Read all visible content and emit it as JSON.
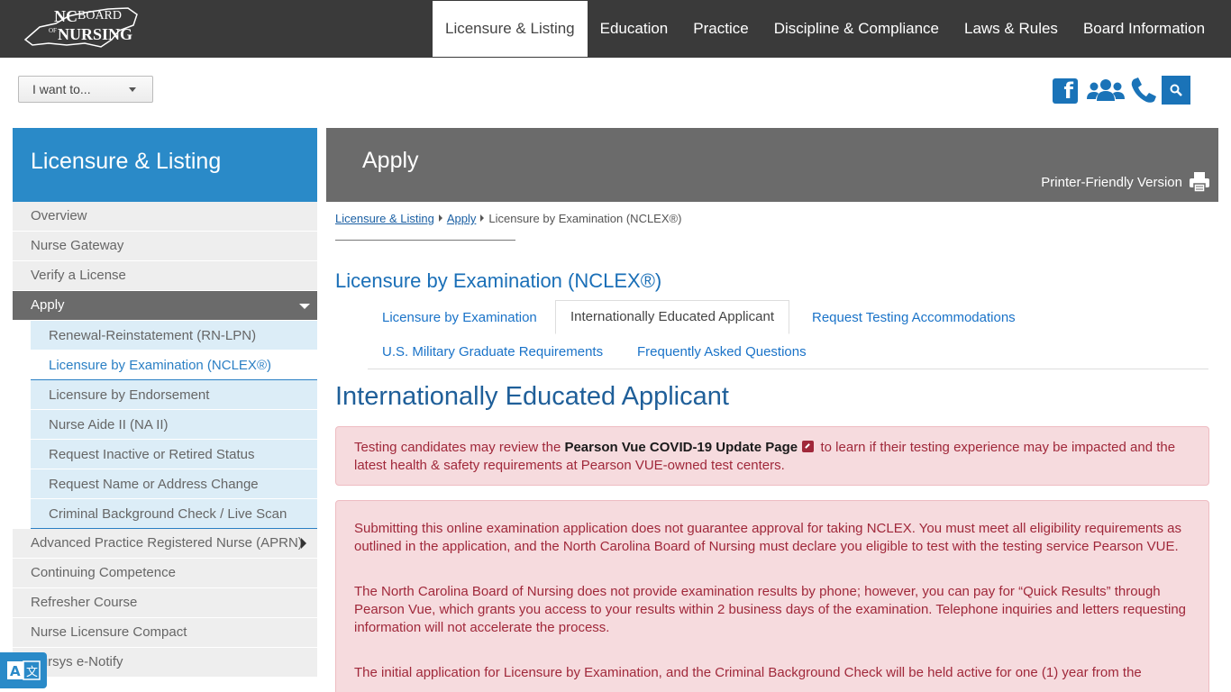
{
  "header": {
    "logo_text": "NC Board of Nursing",
    "nav": [
      {
        "label": "Licensure & Listing",
        "active": true
      },
      {
        "label": "Education"
      },
      {
        "label": "Practice"
      },
      {
        "label": "Discipline & Compliance"
      },
      {
        "label": "Laws & Rules"
      },
      {
        "label": "Board Information"
      }
    ]
  },
  "toolbar": {
    "i_want_to": "I want to...",
    "icons": [
      "facebook-icon",
      "people-icon",
      "phone-icon",
      "search-icon"
    ],
    "accent_color": "#1a73b8"
  },
  "sidebar": {
    "title": "Licensure & Listing",
    "items": [
      {
        "label": "Overview"
      },
      {
        "label": "Nurse Gateway"
      },
      {
        "label": "Verify a License"
      },
      {
        "label": "Apply",
        "active": true
      },
      {
        "label": "Advanced Practice Registered Nurse (APRN)"
      },
      {
        "label": "Continuing Competence"
      },
      {
        "label": "Refresher Course"
      },
      {
        "label": "Nurse Licensure Compact"
      },
      {
        "label": "Nursys e-Notify"
      }
    ],
    "sub_items": [
      {
        "label": "Renewal-Reinstatement (RN-LPN)"
      },
      {
        "label": "Licensure by Examination (NCLEX®)",
        "current": true
      },
      {
        "label": "Licensure by Endorsement"
      },
      {
        "label": "Nurse Aide II (NA II)"
      },
      {
        "label": "Request Inactive or Retired Status"
      },
      {
        "label": "Request Name or Address Change"
      },
      {
        "label": "Criminal Background Check / Live Scan"
      }
    ]
  },
  "content": {
    "header_title": "Apply",
    "printer_label": "Printer-Friendly Version",
    "breadcrumb": {
      "crumb1": "Licensure & Listing",
      "crumb2": "Apply",
      "current": "Licensure by Examination (NCLEX®)"
    },
    "section_title": "Licensure by Examination (NCLEX®)",
    "tabs": [
      {
        "label": "Licensure by Examination"
      },
      {
        "label": "Internationally Educated Applicant",
        "active": true
      },
      {
        "label": "Request Testing Accommodations"
      },
      {
        "label": "U.S. Military Graduate Requirements"
      },
      {
        "label": "Frequently Asked Questions"
      }
    ],
    "page_heading": "Internationally Educated Applicant",
    "alert1": {
      "before": "Testing candidates may review the ",
      "link": "Pearson Vue COVID-19 Update Page",
      "after": " to learn if their testing experience may be impacted and the latest health & safety requirements at Pearson VUE-owned test centers."
    },
    "alert2": {
      "p1": "Submitting this online examination application does not guarantee approval for taking NCLEX. You must meet all eligibility requirements as outlined in the application, and the North Carolina Board of Nursing must declare you eligible to test with the testing service Pearson VUE.",
      "p2": "The North Carolina Board of Nursing does not provide examination results by phone; however, you can pay for “Quick Results” through Pearson Vue, which grants you access to your results within 2 business days of the examination. Telephone inquiries and letters requesting information will not accelerate the process.",
      "p3": "The initial application for Licensure by Examination, and the Criminal Background Check will be held active for one (1) year from the"
    }
  }
}
